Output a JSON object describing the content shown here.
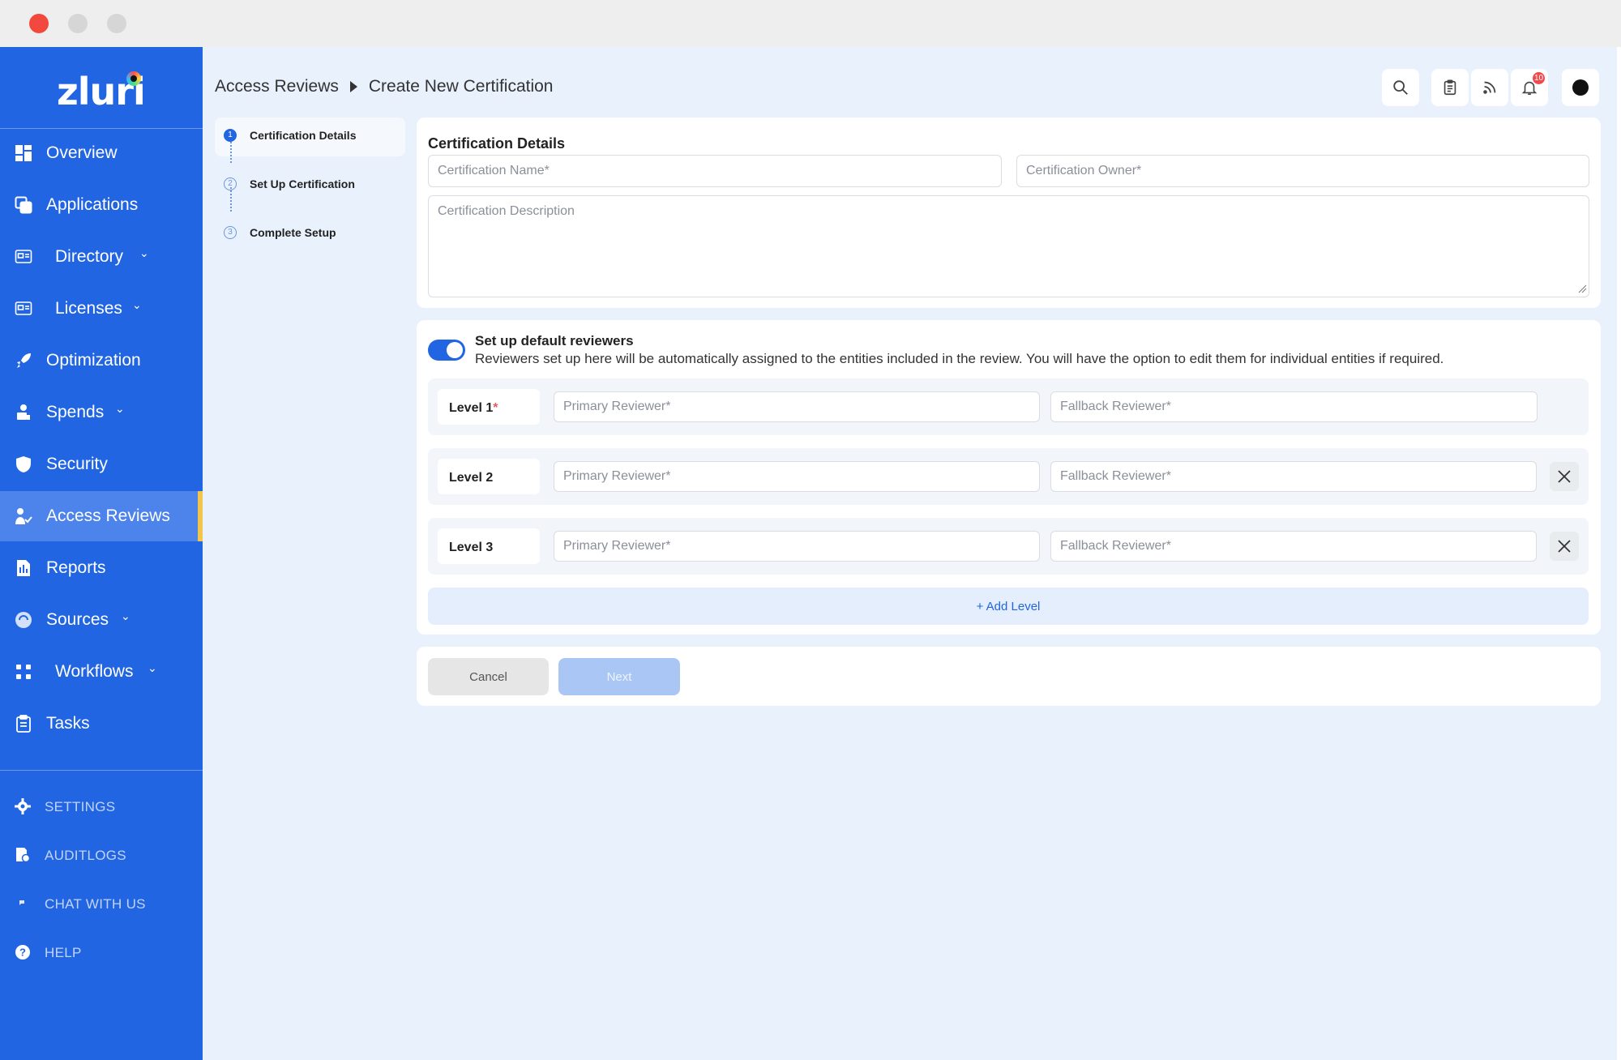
{
  "brand": {
    "logo_text": "zluri",
    "primary_color": "#2165e3",
    "active_accent": "#f3c64a"
  },
  "window": {
    "controls": [
      "close",
      "minimize",
      "maximize"
    ]
  },
  "sidebar": {
    "items": [
      {
        "label": "Overview",
        "icon": "overview-icon",
        "has_chevron": false
      },
      {
        "label": "Applications",
        "icon": "applications-icon",
        "has_chevron": false
      },
      {
        "label": "Directory",
        "icon": "directory-icon",
        "has_chevron": true
      },
      {
        "label": "Licenses",
        "icon": "licenses-icon",
        "has_chevron": true
      },
      {
        "label": "Optimization",
        "icon": "rocket-icon",
        "has_chevron": false
      },
      {
        "label": "Spends",
        "icon": "spends-icon",
        "has_chevron": true
      },
      {
        "label": "Security",
        "icon": "shield-icon",
        "has_chevron": false
      },
      {
        "label": "Access Reviews",
        "icon": "access-reviews-icon",
        "has_chevron": false,
        "active": true
      },
      {
        "label": "Reports",
        "icon": "reports-icon",
        "has_chevron": false
      },
      {
        "label": "Sources",
        "icon": "sources-icon",
        "has_chevron": true
      },
      {
        "label": "Workflows",
        "icon": "workflows-icon",
        "has_chevron": true
      },
      {
        "label": "Tasks",
        "icon": "tasks-icon",
        "has_chevron": false
      }
    ],
    "chevron": "⌄",
    "settings_items": [
      {
        "label": "SETTINGS",
        "icon": "gear-icon"
      },
      {
        "label": "AUDITLOGS",
        "icon": "audit-logs-icon"
      },
      {
        "label": "CHAT WITH US",
        "icon": "chat-icon"
      },
      {
        "label": "HELP",
        "icon": "help-icon"
      }
    ]
  },
  "header": {
    "breadcrumb": [
      "Access Reviews",
      "Create New Certification"
    ],
    "actions": [
      "search-icon",
      "clipboard-icon",
      "feed-icon",
      "bell-icon",
      "avatar"
    ],
    "notification_count": "10"
  },
  "steps": [
    {
      "num": "1",
      "label": "Certification Details",
      "state": "active"
    },
    {
      "num": "2",
      "label": "Set Up Certification",
      "state": "pending"
    },
    {
      "num": "3",
      "label": "Complete Setup",
      "state": "pending"
    }
  ],
  "details": {
    "title": "Certification Details",
    "name_placeholder": "Certification Name*",
    "owner_placeholder": "Certification Owner*",
    "description_placeholder": "Certification Description"
  },
  "reviewers": {
    "toggle_on": true,
    "title": "Set up default reviewers",
    "description": "Reviewers set up here will be automatically assigned to the entities included in the review. You will have the option to edit them for individual entities if required.",
    "levels": [
      {
        "label": "Level 1",
        "required_mark": "*",
        "primary_placeholder": "Primary Reviewer*",
        "fallback_placeholder": "Fallback Reviewer*",
        "removable": false
      },
      {
        "label": "Level 2",
        "required_mark": "",
        "primary_placeholder": "Primary Reviewer*",
        "fallback_placeholder": "Fallback Reviewer*",
        "removable": true
      },
      {
        "label": "Level 3",
        "required_mark": "",
        "primary_placeholder": "Primary Reviewer*",
        "fallback_placeholder": "Fallback Reviewer*",
        "removable": true
      }
    ],
    "add_level_label": "+ Add Level"
  },
  "footer": {
    "cancel_label": "Cancel",
    "next_label": "Next"
  }
}
